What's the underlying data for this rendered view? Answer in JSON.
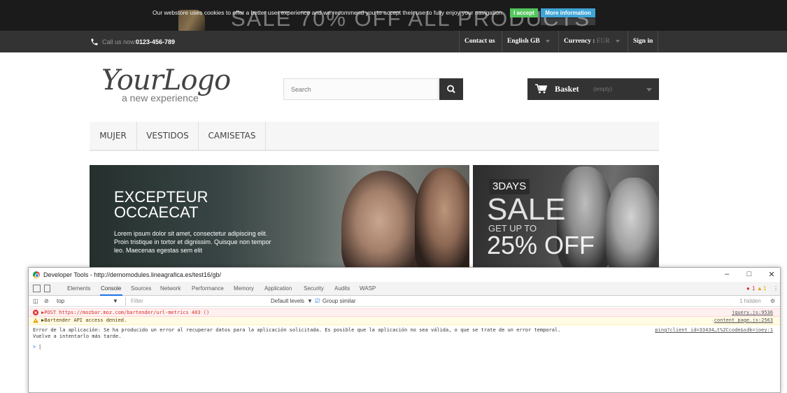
{
  "cookie_bar": {
    "promo": "SALE 70% OFF ALL PRODUCTS",
    "message": "Our webstore uses cookies to offer a better user experience and we recommend you to accept their use to fully enjoy your navigation.",
    "accept_label": "I accept",
    "more_label": "More information"
  },
  "nav": {
    "call_label": "Call us now:",
    "phone": "0123-456-789",
    "contact": "Contact us",
    "language": "English GB",
    "currency_label": "Currency :",
    "currency_value": "EUR",
    "sign_in": "Sign in"
  },
  "header": {
    "logo_main": "YourLogo",
    "logo_tag": "a new experience",
    "search_placeholder": "Search",
    "basket_label": "Basket",
    "basket_status": "(empty)"
  },
  "menu": {
    "items": [
      "MUJER",
      "VESTIDOS",
      "CAMISETAS"
    ]
  },
  "banner_left": {
    "title_line1": "EXCEPTEUR",
    "title_line2": "OCCAECAT",
    "body": "Lorem ipsum dolor sit amet, consectetur adipiscing elit. Proin tristique in tortor et dignissim. Quisque non tempor leo. Maecenas egestas sem elit"
  },
  "banner_right": {
    "days": "3DAYS",
    "sale": "SALE",
    "get_up": "GET UP TO",
    "off": "25% OFF"
  },
  "devtools": {
    "title": "Developer Tools - http://demomodules.lineagrafica.es/test16/gb/",
    "tabs": [
      "Elements",
      "Console",
      "Sources",
      "Network",
      "Performance",
      "Memory",
      "Application",
      "Security",
      "Audits",
      "WASP"
    ],
    "error_count": "1",
    "warning_count": "1",
    "context": "top",
    "filter_placeholder": "Filter",
    "levels": "Default levels",
    "group_similar": "Group similar",
    "hidden": "1 hidden",
    "messages": [
      {
        "type": "error",
        "text": "▶POST https://mozbar.moz.com/bartender/url-metrics 403 ()",
        "source": "jquery.js:9536"
      },
      {
        "type": "warning",
        "text": "▶Bartender API access denied.",
        "source": "content_page.js:2563"
      },
      {
        "type": "info",
        "text": "Error de la aplicación: Se ha producido un error al recuperar datos para la aplicación solicitada. Es posible que la aplicación no sea válida, o que se trate de un error temporal.",
        "text2": "Vuelve a intentarlo más tarde.",
        "source": "ping?client_id=33434…t%2Ccode&sdk=joey:1"
      }
    ],
    "prompt": ">"
  },
  "colors": {
    "accept_green": "#55c65e",
    "info_blue": "#3fa4d6",
    "nav_dark": "#333333",
    "error_red": "#d4332e"
  }
}
